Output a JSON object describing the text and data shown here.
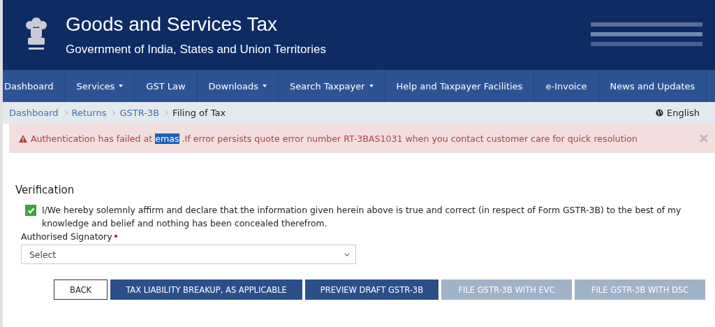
{
  "header": {
    "title": "Goods and Services Tax",
    "subtitle": "Government of India, States and Union Territories"
  },
  "nav": [
    {
      "label": "Dashboard",
      "dropdown": false
    },
    {
      "label": "Services",
      "dropdown": true
    },
    {
      "label": "GST Law",
      "dropdown": false
    },
    {
      "label": "Downloads",
      "dropdown": true
    },
    {
      "label": "Search Taxpayer",
      "dropdown": true
    },
    {
      "label": "Help and Taxpayer Facilities",
      "dropdown": false
    },
    {
      "label": "e-Invoice",
      "dropdown": false
    },
    {
      "label": "News and Updates",
      "dropdown": false
    }
  ],
  "breadcrumb": [
    {
      "label": "Dashboard",
      "current": false
    },
    {
      "label": "Returns",
      "current": false
    },
    {
      "label": "GSTR-3B",
      "current": false
    },
    {
      "label": "Filing of Tax",
      "current": true
    }
  ],
  "language": "English",
  "alert": {
    "before": "Authentication has failed at ",
    "selected_text": "emas",
    "after": " .If error persists quote error number RT-3BAS1031 when you contact customer care for quick resolution"
  },
  "verification": {
    "heading": "Verification",
    "declaration": {
      "checked": true,
      "text": "I/We hereby solemnly affirm and declare that the information given herein above is true and correct (in respect of Form GSTR-3B) to the best of my knowledge and belief and nothing has been concealed therefrom."
    },
    "signatory": {
      "label": "Authorised Signatory",
      "required": true,
      "value": "Select"
    }
  },
  "buttons": [
    {
      "label": "BACK",
      "kind": "outline",
      "disabled": false
    },
    {
      "label": "TAX LIABILITY BREAKUP, AS APPLICABLE",
      "kind": "primary",
      "disabled": false
    },
    {
      "label": "PREVIEW DRAFT GSTR-3B",
      "kind": "primary",
      "disabled": false
    },
    {
      "label": "FILE GSTR-3B WITH EVC",
      "kind": "primary",
      "disabled": true
    },
    {
      "label": "FILE GSTR-3B WITH DSC",
      "kind": "primary",
      "disabled": true
    }
  ]
}
